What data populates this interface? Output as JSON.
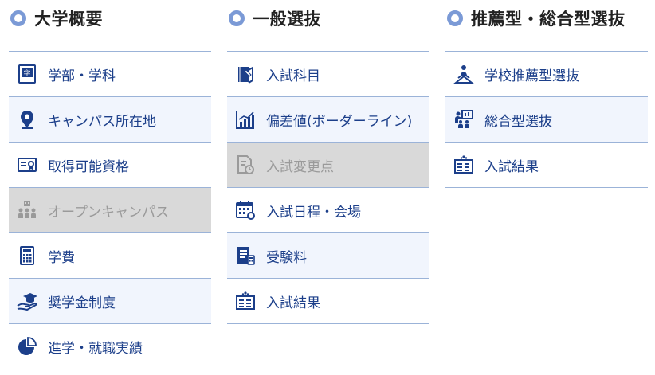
{
  "colors": {
    "accent": "#1c3f8a",
    "row_alt": "#f1f5fd",
    "disabled_bg": "#d9d9d9",
    "disabled_text": "#9a9a9a",
    "divider": "#9bb3d8"
  },
  "columns": [
    {
      "heading": "大学概要",
      "items": [
        {
          "label": "学部・学科",
          "icon": "faculty-book-icon",
          "disabled": false
        },
        {
          "label": "キャンパス所在地",
          "icon": "location-pin-icon",
          "disabled": false
        },
        {
          "label": "取得可能資格",
          "icon": "certificate-icon",
          "disabled": false
        },
        {
          "label": "オープンキャンパス",
          "icon": "open-campus-icon",
          "disabled": true
        },
        {
          "label": "学費",
          "icon": "calculator-icon",
          "disabled": false
        },
        {
          "label": "奨学金制度",
          "icon": "scholarship-icon",
          "disabled": false
        },
        {
          "label": "進学・就職実績",
          "icon": "pie-chart-icon",
          "disabled": false
        }
      ]
    },
    {
      "heading": "一般選抜",
      "items": [
        {
          "label": "入試科目",
          "icon": "exam-subject-icon",
          "disabled": false
        },
        {
          "label": "偏差値(ボーダーライン)",
          "icon": "bar-chart-icon",
          "disabled": false
        },
        {
          "label": "入試変更点",
          "icon": "document-change-icon",
          "disabled": true
        },
        {
          "label": "入試日程・会場",
          "icon": "calendar-icon",
          "disabled": false
        },
        {
          "label": "受験料",
          "icon": "fee-document-icon",
          "disabled": false
        },
        {
          "label": "入試結果",
          "icon": "results-board-icon",
          "disabled": false
        }
      ]
    },
    {
      "heading": "推薦型・総合型選抜",
      "items": [
        {
          "label": "学校推薦型選抜",
          "icon": "recommendation-icon",
          "disabled": false
        },
        {
          "label": "総合型選抜",
          "icon": "presentation-icon",
          "disabled": false
        },
        {
          "label": "入試結果",
          "icon": "results-board-icon",
          "disabled": false
        }
      ]
    }
  ]
}
